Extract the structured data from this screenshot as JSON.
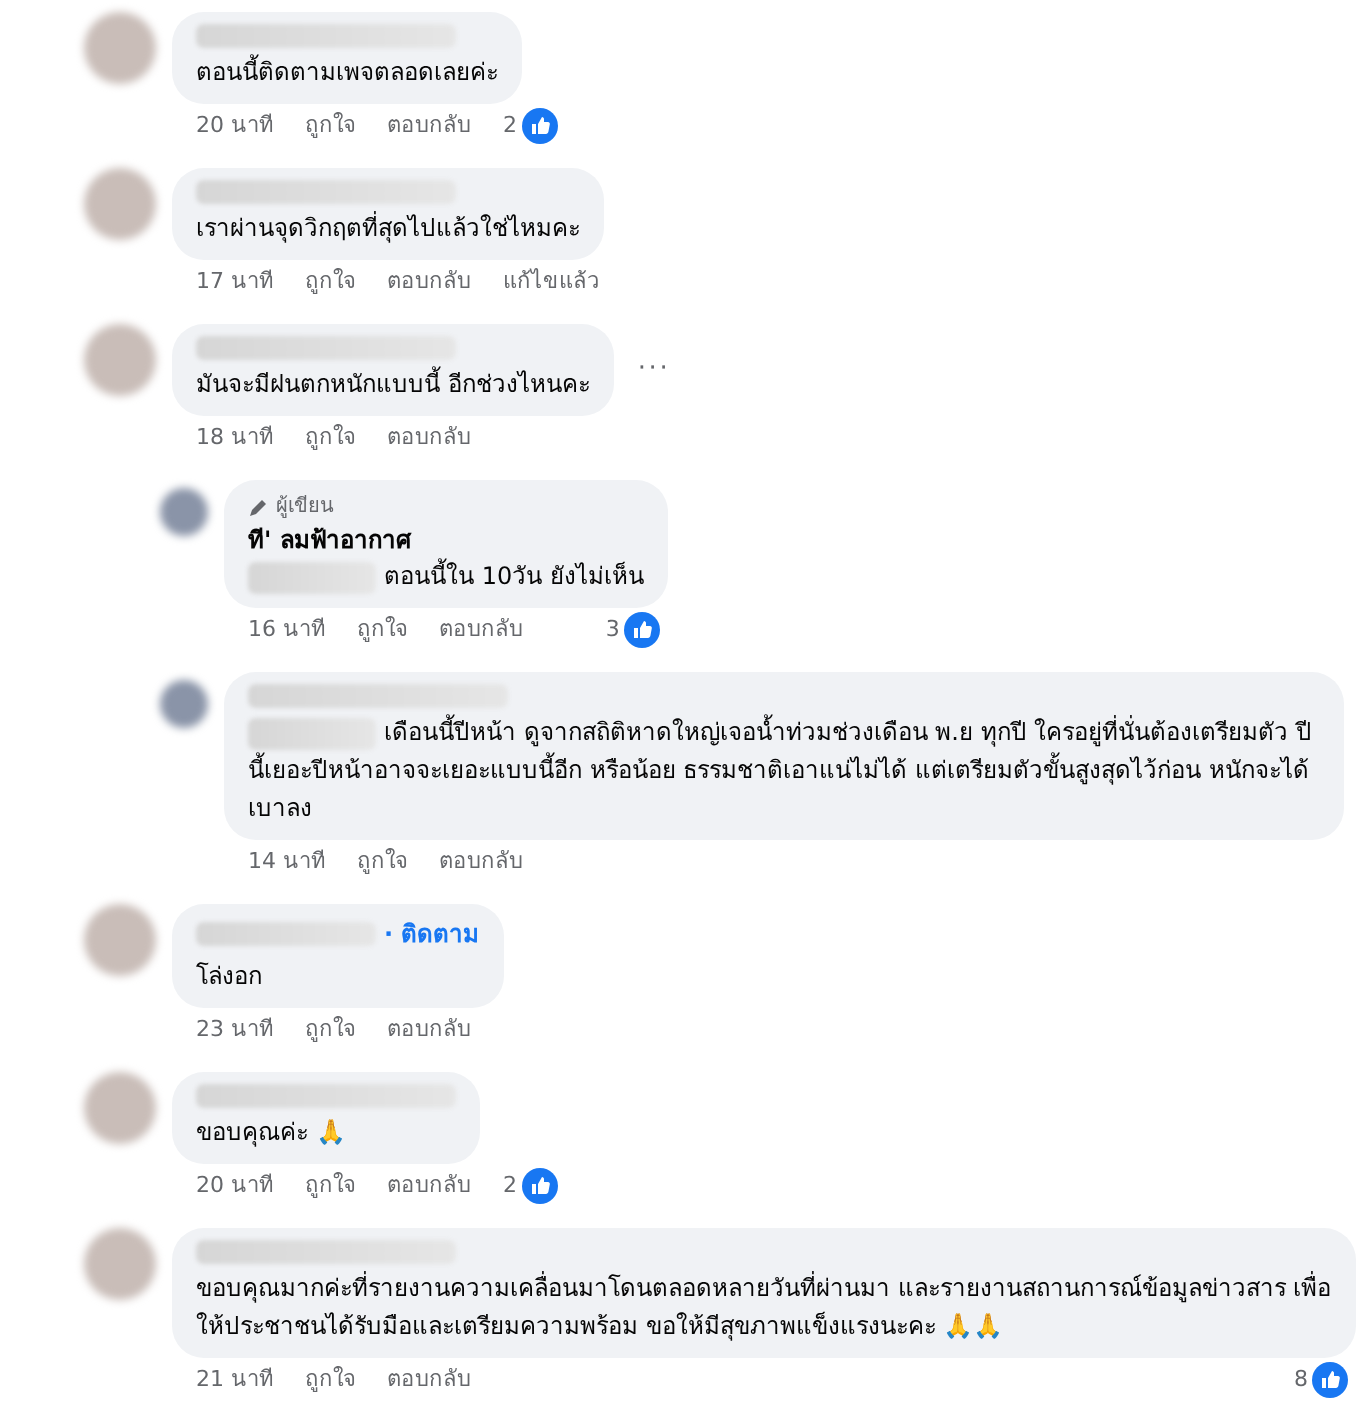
{
  "comments": [
    {
      "reply": false,
      "text": "ตอนนี้ติดตามเพจตลอดเลยค่ะ",
      "time": "20 นาที",
      "like_label": "ถูกใจ",
      "reply_label": "ตอบกลับ",
      "reactions": "2"
    },
    {
      "reply": false,
      "text": "เราผ่านจุดวิกฤตที่สุดไปแล้วใช่ไหมคะ",
      "time": "17 นาที",
      "like_label": "ถูกใจ",
      "reply_label": "ตอบกลับ",
      "edited": "แก้ไขแล้ว"
    },
    {
      "reply": false,
      "text": "มันจะมีฝนตกหนักแบบนี้ อีกช่วงไหนคะ",
      "time": "18 นาที",
      "like_label": "ถูกใจ",
      "reply_label": "ตอบกลับ",
      "more": "···"
    },
    {
      "reply": true,
      "badge": "ผู้เขียน",
      "author": "ที' ลมฟ้าอากาศ",
      "mention": true,
      "text": "ตอนนี้ใน 10วัน ยังไม่เห็น",
      "time": "16 นาที",
      "like_label": "ถูกใจ",
      "reply_label": "ตอบกลับ",
      "reactions": "3"
    },
    {
      "reply": true,
      "mention": true,
      "text": "เดือนนี้ปีหน้า ดูจากสถิติหาดใหญ่เจอน้ำท่วมช่วงเดือน พ.ย ทุกปี ใครอยู่ที่นั่นต้องเตรียมตัว ปีนี้เยอะปีหน้าอาจจะเยอะแบบนี้อีก หรือน้อย ธรรมชาติเอาแน่ไม่ได้ แต่เตรียมตัวขั้นสูงสุดไว้ก่อน หนักจะได้เบาลง",
      "time": "14 นาที",
      "like_label": "ถูกใจ",
      "reply_label": "ตอบกลับ"
    },
    {
      "reply": false,
      "follow": "· ติดตาม",
      "text": "โล่งอก",
      "time": "23 นาที",
      "like_label": "ถูกใจ",
      "reply_label": "ตอบกลับ"
    },
    {
      "reply": false,
      "text": "ขอบคุณค่ะ 🙏",
      "time": "20 นาที",
      "like_label": "ถูกใจ",
      "reply_label": "ตอบกลับ",
      "reactions": "2"
    },
    {
      "reply": false,
      "text": "ขอบคุณมากค่ะที่รายงานความเคลื่อนมาโดนตลอดหลายวันที่ผ่านมา และรายงานสถานการณ์ข้อมูลข่าวสาร เพื่อให้ประชาชนได้รับมือและเตรียมความพร้อม ขอให้มีสุขภาพแข็งแรงนะคะ 🙏🙏",
      "time": "21 นาที",
      "like_label": "ถูกใจ",
      "reply_label": "ตอบกลับ",
      "reactions": "8"
    }
  ]
}
